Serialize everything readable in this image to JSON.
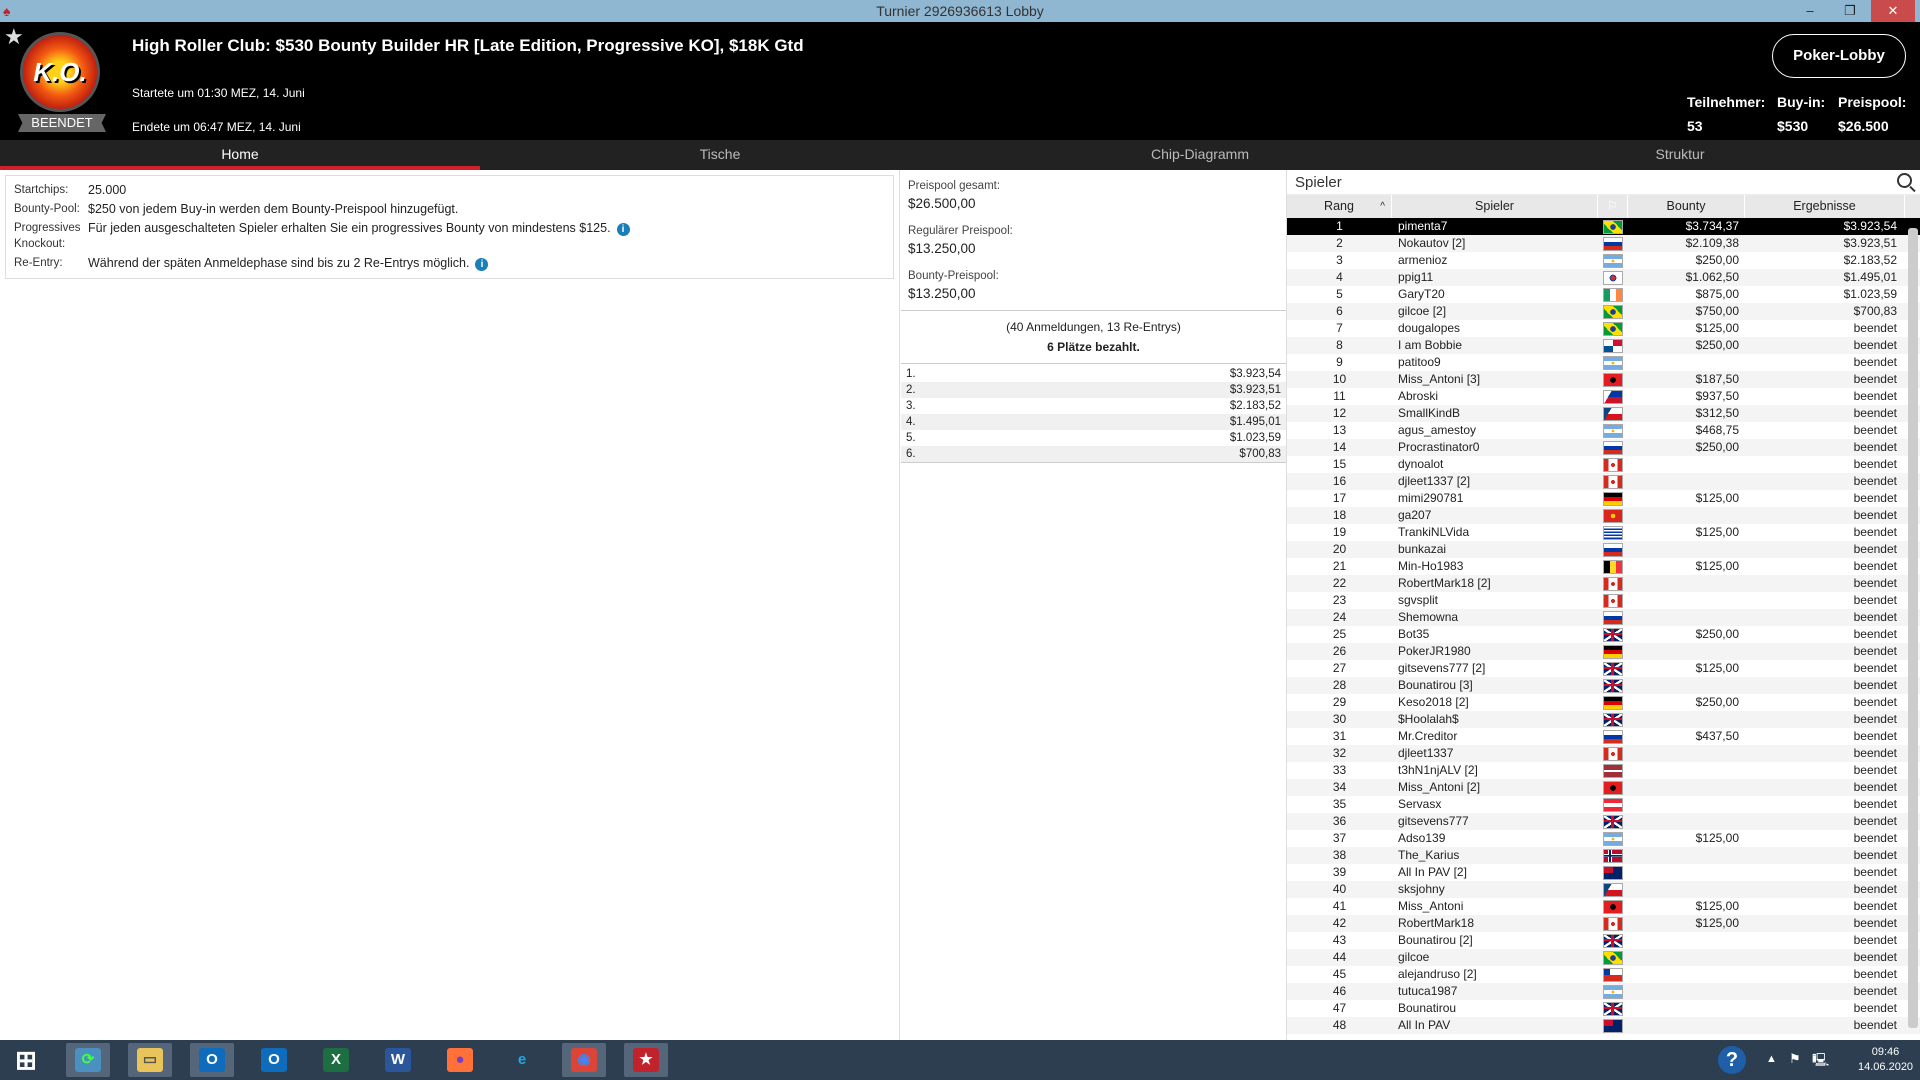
{
  "window": {
    "title": "Turnier 2926936613 Lobby"
  },
  "header": {
    "title": "High Roller Club: $530 Bounty Builder HR [Late Edition, Progressive KO], $18K Gtd",
    "logo_text": "K.O.",
    "status": "BEENDET",
    "started": "Startete um 01:30 MEZ, 14. Juni",
    "ended": "Endete um 06:47 MEZ, 14. Juni",
    "lobby_button": "Poker-Lobby",
    "stats": [
      {
        "label": "Teilnehmer:",
        "value": "53"
      },
      {
        "label": "Buy-in:",
        "value": "$530"
      },
      {
        "label": "Preispool:",
        "value": "$26.500"
      }
    ]
  },
  "tabs": [
    "Home",
    "Tische",
    "Chip-Diagramm",
    "Struktur"
  ],
  "info": [
    {
      "key": "Startchips:",
      "value": "25.000"
    },
    {
      "key": "Bounty-Pool:",
      "value": "$250 von jedem Buy-in werden dem Bounty-Preispool hinzugefügt."
    },
    {
      "key": "Progressives Knockout:",
      "value": "Für jeden ausgeschalteten Spieler erhalten Sie ein progressives Bounty von mindestens $125."
    },
    {
      "key": "Re-Entry:",
      "value": "Während der späten Anmeldephase sind bis zu 2 Re-Entrys möglich."
    }
  ],
  "prizepool": {
    "total_label": "Preispool gesamt:",
    "total": "$26.500,00",
    "regular_label": "Regulärer Preispool:",
    "regular": "$13.250,00",
    "bounty_label": "Bounty-Preispool:",
    "bounty": "$13.250,00",
    "entries": "(40 Anmeldungen, 13 Re-Entrys)",
    "paid": "6 Plätze bezahlt.",
    "payouts": [
      [
        "1.",
        "$3.923,54"
      ],
      [
        "2.",
        "$3.923,51"
      ],
      [
        "3.",
        "$2.183,52"
      ],
      [
        "4.",
        "$1.495,01"
      ],
      [
        "5.",
        "$1.023,59"
      ],
      [
        "6.",
        "$700,83"
      ]
    ]
  },
  "players": {
    "search_placeholder": "Spieler",
    "columns": [
      "Rang",
      "Spieler",
      "",
      "Bounty",
      "Ergebnisse"
    ],
    "rows": [
      [
        1,
        "pimenta7",
        "br",
        "$3.734,37",
        "$3.923,54"
      ],
      [
        2,
        "Nokautov [2]",
        "ru",
        "$2.109,38",
        "$3.923,51"
      ],
      [
        3,
        "armenioz",
        "ar",
        "$250,00",
        "$2.183,52"
      ],
      [
        4,
        "ppig11",
        "kr",
        "$1.062,50",
        "$1.495,01"
      ],
      [
        5,
        "GaryT20",
        "ie",
        "$875,00",
        "$1.023,59"
      ],
      [
        6,
        "gilcoe [2]",
        "br",
        "$750,00",
        "$700,83"
      ],
      [
        7,
        "dougalopes",
        "br",
        "$125,00",
        "beendet"
      ],
      [
        8,
        "I am Bobbie",
        "pa",
        "$250,00",
        "beendet"
      ],
      [
        9,
        "patitoo9",
        "ar",
        "",
        "beendet"
      ],
      [
        10,
        "Miss_Antoni [3]",
        "al",
        "$187,50",
        "beendet"
      ],
      [
        11,
        "Abroski",
        "ph",
        "$937,50",
        "beendet"
      ],
      [
        12,
        "SmallKindB",
        "cz",
        "$312,50",
        "beendet"
      ],
      [
        13,
        "agus_amestoy",
        "ar",
        "$468,75",
        "beendet"
      ],
      [
        14,
        "Procrastinator0",
        "ru",
        "$250,00",
        "beendet"
      ],
      [
        15,
        "dynoalot",
        "ca",
        "",
        "beendet"
      ],
      [
        16,
        "djleet1337 [2]",
        "ca",
        "",
        "beendet"
      ],
      [
        17,
        "mimi290781",
        "de",
        "$125,00",
        "beendet"
      ],
      [
        18,
        "ga207",
        "vn",
        "",
        "beendet"
      ],
      [
        19,
        "TrankiNLVida",
        "uy",
        "$125,00",
        "beendet"
      ],
      [
        20,
        "bunkazai",
        "ru",
        "",
        "beendet"
      ],
      [
        21,
        "Min-Ho1983",
        "be",
        "$125,00",
        "beendet"
      ],
      [
        22,
        "RobertMark18 [2]",
        "ca",
        "",
        "beendet"
      ],
      [
        23,
        "sgvsplit",
        "ca",
        "",
        "beendet"
      ],
      [
        24,
        "Shemowna",
        "ru",
        "",
        "beendet"
      ],
      [
        25,
        "Bot35",
        "gb",
        "$250,00",
        "beendet"
      ],
      [
        26,
        "PokerJR1980",
        "de",
        "",
        "beendet"
      ],
      [
        27,
        "gitsevens777 [2]",
        "gb",
        "$125,00",
        "beendet"
      ],
      [
        28,
        "Bounatirou [3]",
        "gb",
        "",
        "beendet"
      ],
      [
        29,
        "Keso2018 [2]",
        "de",
        "$250,00",
        "beendet"
      ],
      [
        30,
        "$Hoolalah$",
        "gb",
        "",
        "beendet"
      ],
      [
        31,
        "Mr.Creditor",
        "ru",
        "$437,50",
        "beendet"
      ],
      [
        32,
        "djleet1337",
        "ca",
        "",
        "beendet"
      ],
      [
        33,
        "t3hN1njALV [2]",
        "lv",
        "",
        "beendet"
      ],
      [
        34,
        "Miss_Antoni [2]",
        "al",
        "",
        "beendet"
      ],
      [
        35,
        "Servasx",
        "at",
        "",
        "beendet"
      ],
      [
        36,
        "gitsevens777",
        "gb",
        "",
        "beendet"
      ],
      [
        37,
        "Adso139",
        "ar",
        "$125,00",
        "beendet"
      ],
      [
        38,
        "The_Karius",
        "no",
        "",
        "beendet"
      ],
      [
        39,
        "All In PAV [2]",
        "au",
        "",
        "beendet"
      ],
      [
        40,
        "sksjohny",
        "cz",
        "",
        "beendet"
      ],
      [
        41,
        "Miss_Antoni",
        "al",
        "$125,00",
        "beendet"
      ],
      [
        42,
        "RobertMark18",
        "ca",
        "$125,00",
        "beendet"
      ],
      [
        43,
        "Bounatirou [2]",
        "gb",
        "",
        "beendet"
      ],
      [
        44,
        "gilcoe",
        "br",
        "",
        "beendet"
      ],
      [
        45,
        "alejandruso [2]",
        "cl",
        "",
        "beendet"
      ],
      [
        46,
        "tutuca1987",
        "ar",
        "",
        "beendet"
      ],
      [
        47,
        "Bounatirou",
        "gb",
        "",
        "beendet"
      ],
      [
        48,
        "All In PAV",
        "au",
        "",
        "beendet"
      ]
    ]
  },
  "taskbar": {
    "apps": [
      "start",
      "sync",
      "explorer",
      "outlook-old",
      "outlook",
      "excel",
      "word",
      "firefox",
      "ie",
      "chrome",
      "pokerstars"
    ],
    "time": "09:46",
    "date": "14.06.2020"
  }
}
